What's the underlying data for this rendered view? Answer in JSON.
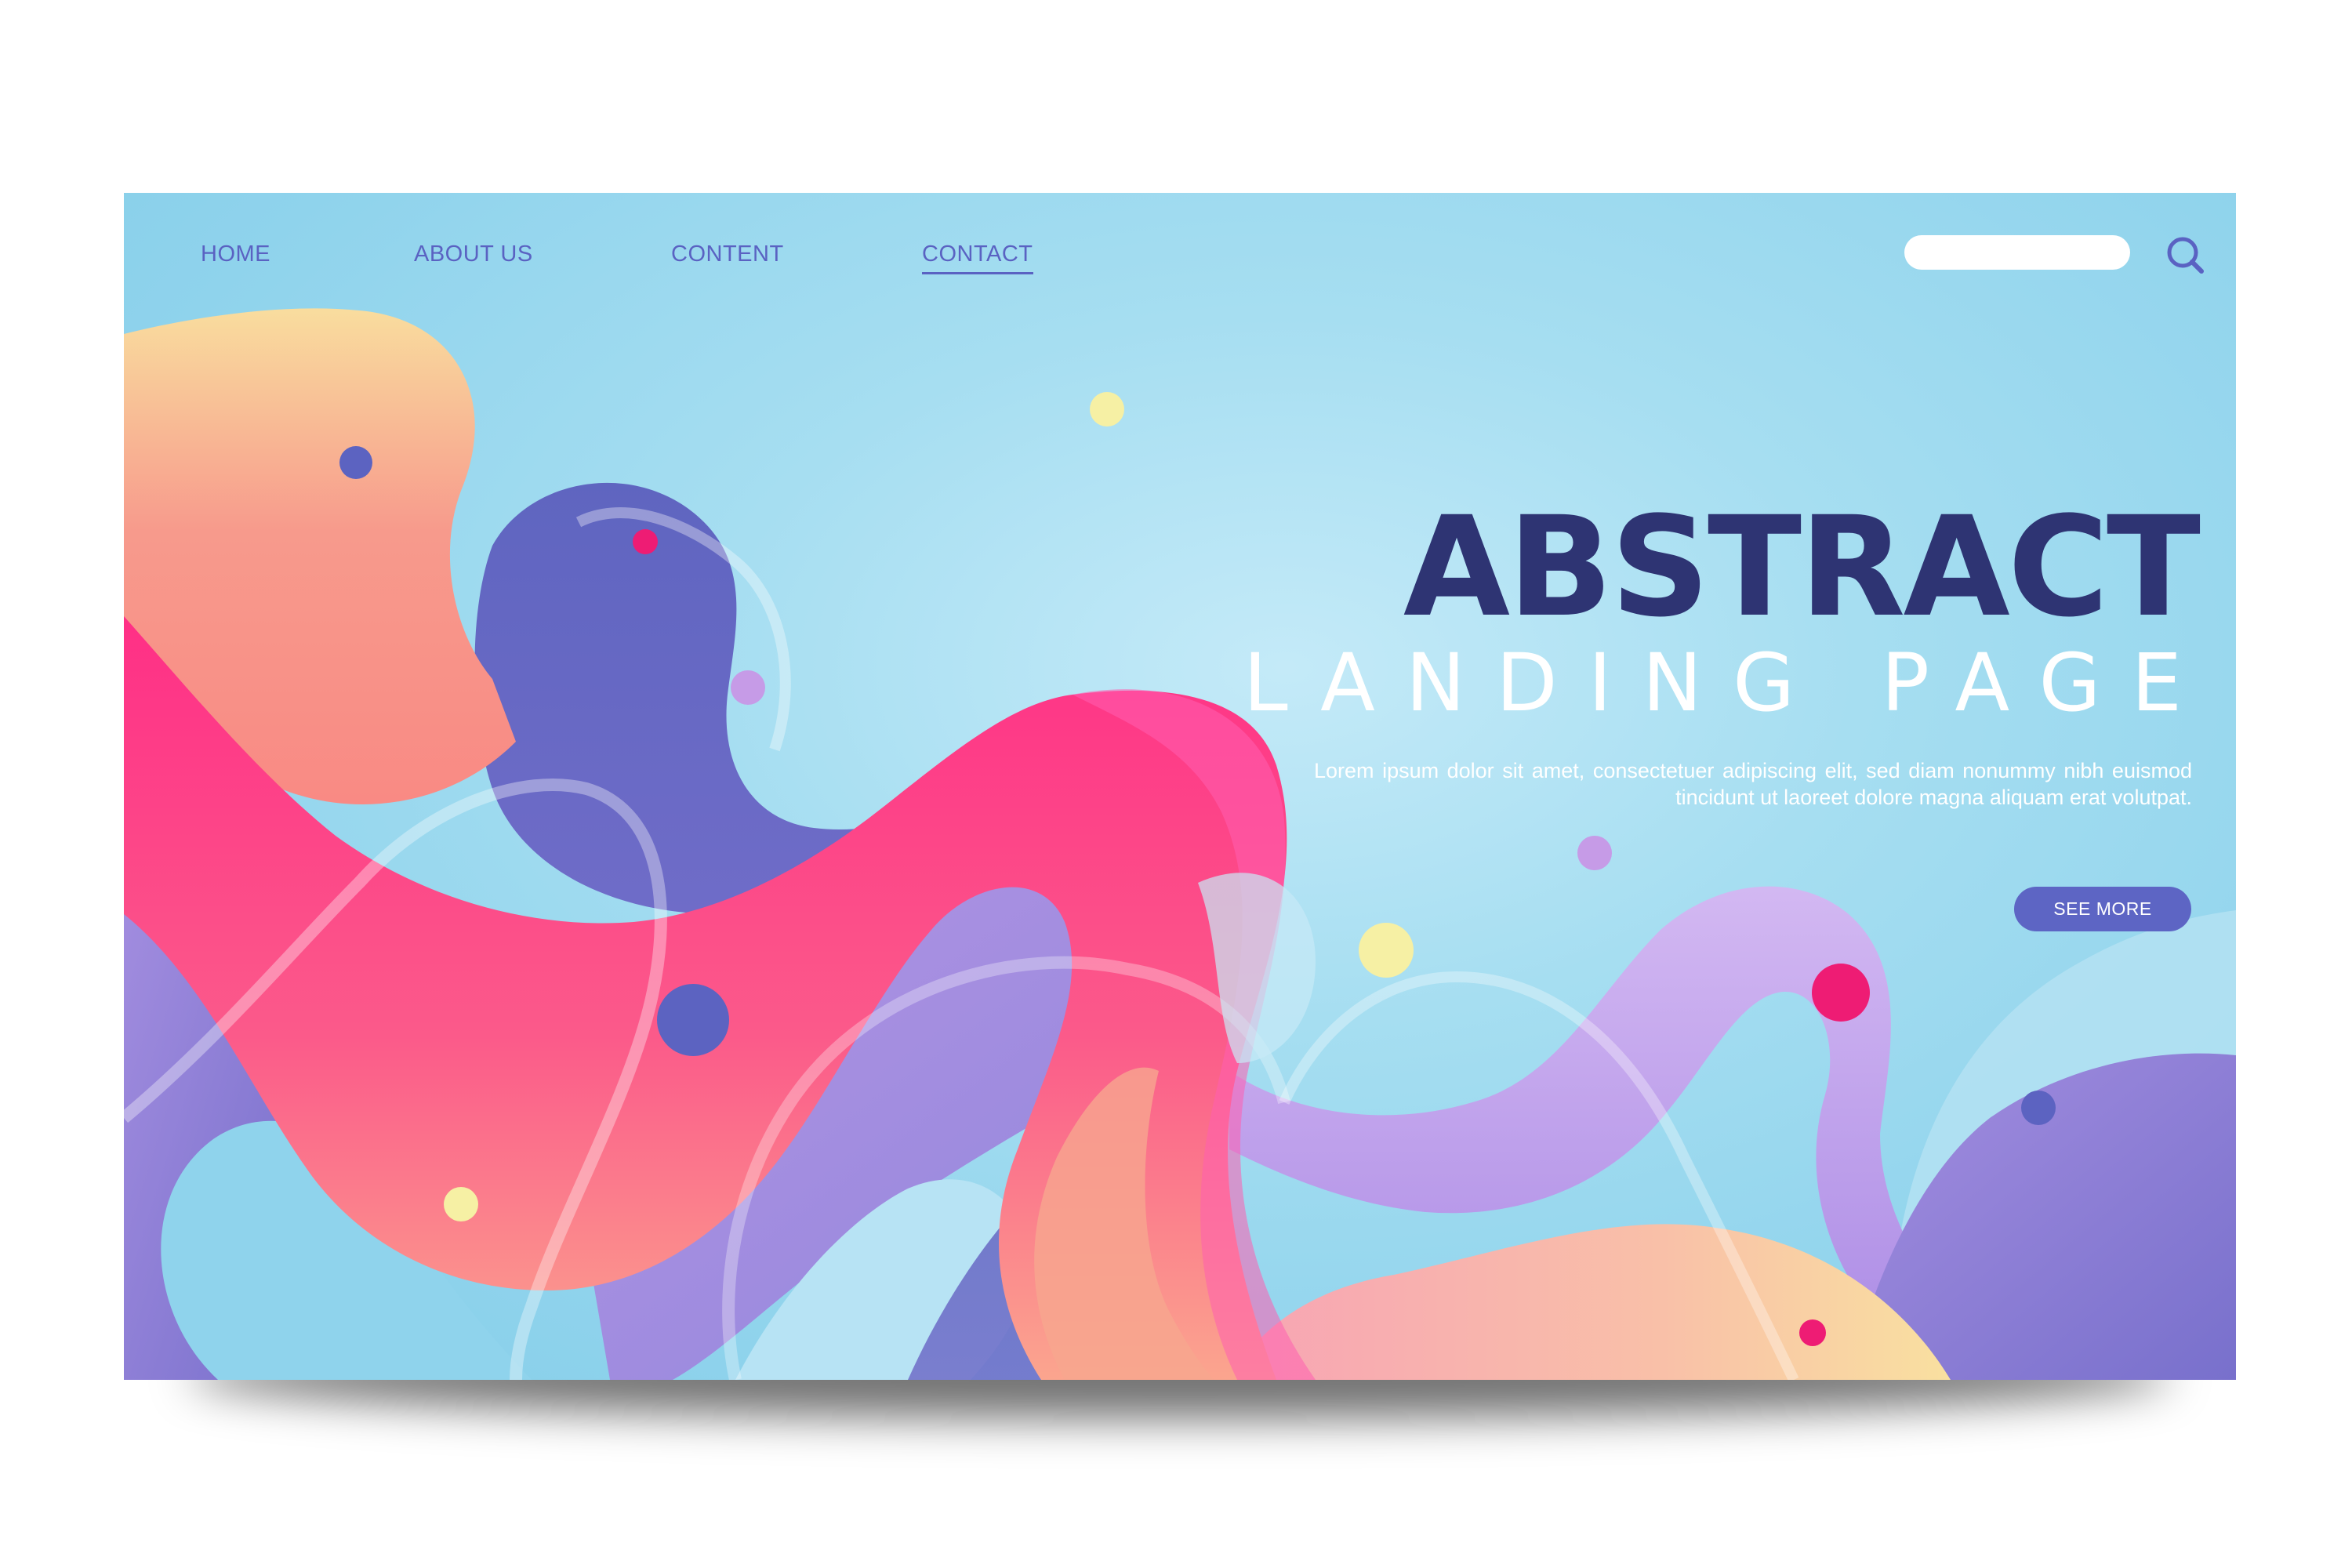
{
  "nav": {
    "items": [
      {
        "label": "HOME"
      },
      {
        "label": "ABOUT US"
      },
      {
        "label": "CONTENT"
      },
      {
        "label": "CONTACT",
        "active": true
      }
    ]
  },
  "search": {
    "placeholder": "",
    "icon": "search-icon"
  },
  "hero": {
    "title": "ABSTRACT",
    "subtitle": "LANDING PAGE",
    "description": "Lorem ipsum dolor sit amet, consectetuer adipiscing elit, sed diam nonummy nibh euismod tincidunt ut laoreet dolore magna aliquam erat volutpat.",
    "cta_label": "SEE MORE"
  },
  "colors": {
    "background": "#a6def1",
    "nav_text": "#5a62c2",
    "title": "#2e3473",
    "button": "#5d65c4",
    "pink": "#ff3c88",
    "peach": "#f8c79a",
    "purple": "#6a68c2",
    "lavender": "#b89ae6",
    "magenta_dot": "#ee1c74",
    "yellow_dot": "#f6f0a4"
  }
}
